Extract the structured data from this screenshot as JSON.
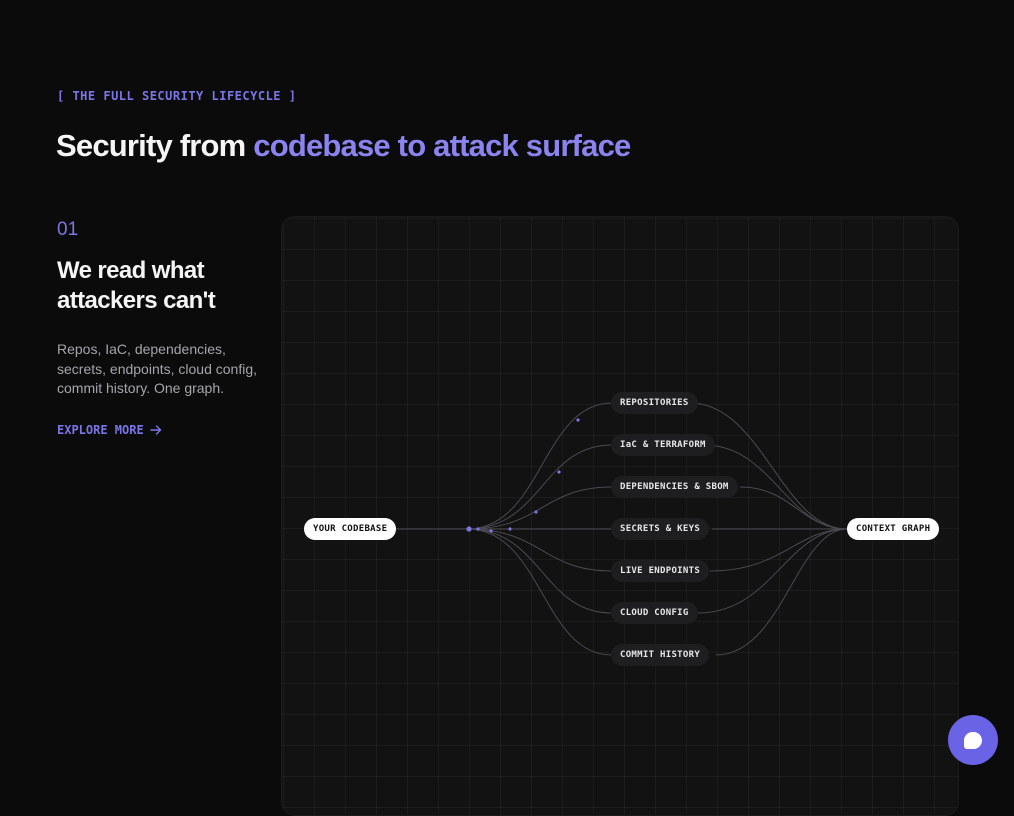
{
  "section": {
    "eyebrow": "[ THE FULL SECURITY LIFECYCLE ]",
    "headline_part1": "Security from ",
    "headline_accent": "codebase to attack surface"
  },
  "step": {
    "number": "01",
    "title": "We read what attackers can't",
    "description": "Repos, IaC, dependencies, secrets, endpoints, cloud config, commit history. One graph.",
    "cta_label": "EXPLORE MORE"
  },
  "diagram": {
    "source": "YOUR CODEBASE",
    "target": "CONTEXT GRAPH",
    "nodes": [
      "REPOSITORIES",
      "IaC & TERRAFORM",
      "DEPENDENCIES & SBOM",
      "SECRETS & KEYS",
      "LIVE ENDPOINTS",
      "CLOUD CONFIG",
      "COMMIT HISTORY"
    ]
  },
  "colors": {
    "background": "#0b0b0c",
    "accent": "#7b75e6",
    "panel": "#121213",
    "node_dark": "#1e1e20"
  },
  "icons": {
    "cta": "arrow-right-icon",
    "chat": "chat-bubble-icon"
  }
}
